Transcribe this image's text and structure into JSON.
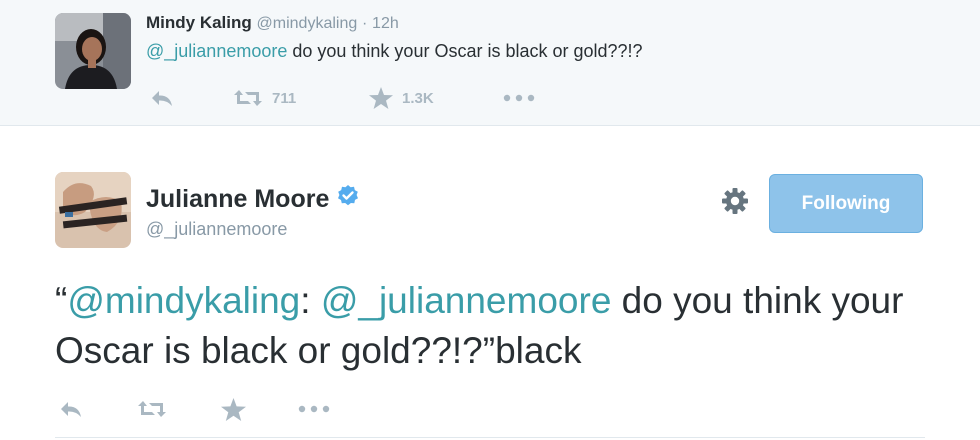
{
  "reply_tweet": {
    "author_name": "Mindy Kaling",
    "author_handle": "@mindykaling",
    "separator": "·",
    "time": "12h",
    "mention": "@_juliannemoore",
    "text": " do you think your Oscar is black or gold??!?",
    "retweet_count": "711",
    "favorite_count": "1.3K"
  },
  "main_tweet": {
    "author_name": "Julianne Moore",
    "author_handle": "@_juliannemoore",
    "follow_label": "Following",
    "text_open_quote": "“",
    "text_mention_1": "@mindykaling",
    "text_colon": ": ",
    "text_mention_2": "@_juliannemoore",
    "text_rest": " do you think your Oscar is black or gold??!?”black"
  },
  "colors": {
    "mention": "#3a9da8",
    "follow_button": "#8ec3ea",
    "icon": "#aab8c2",
    "verified": "#55acee"
  }
}
